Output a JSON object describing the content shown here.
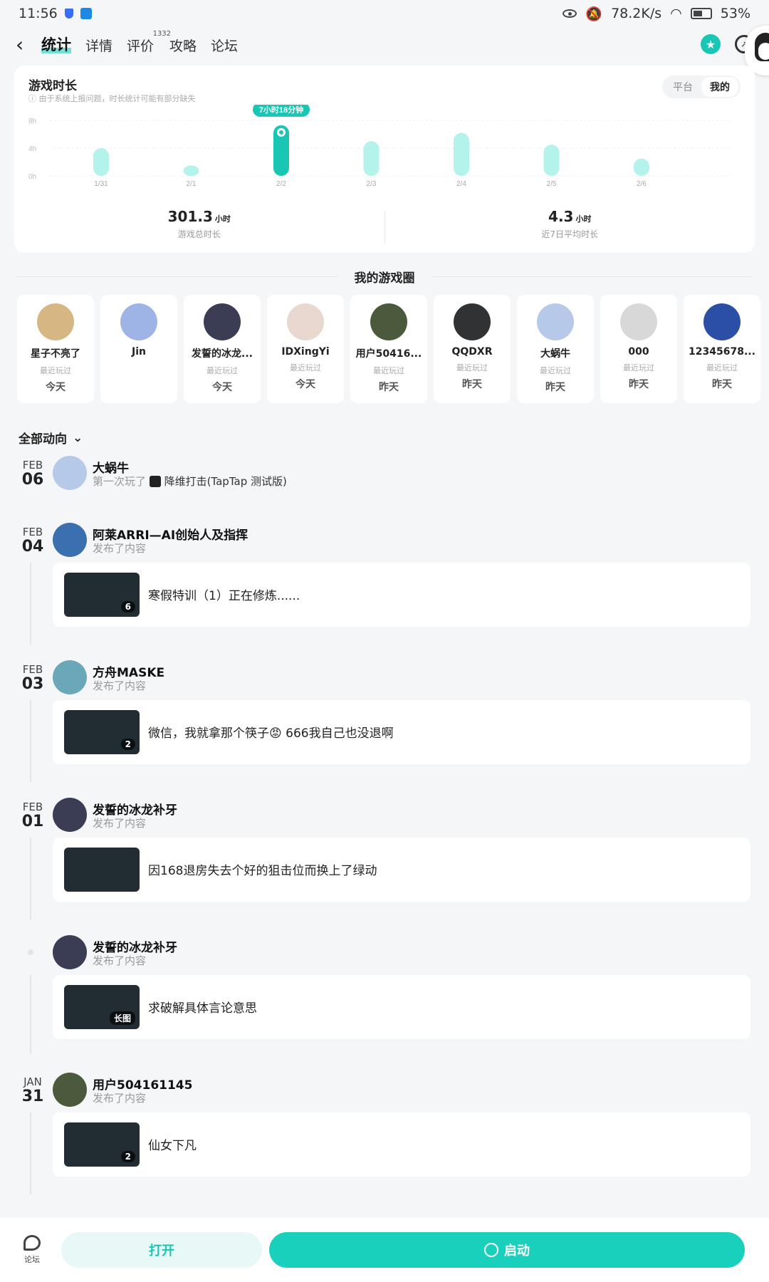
{
  "status": {
    "time": "11:56",
    "speed": "78.2K/s",
    "battery": "53%"
  },
  "header": {
    "tabs": [
      {
        "label": "统计",
        "active": true
      },
      {
        "label": "详情"
      },
      {
        "label": "评价",
        "count": "1332"
      },
      {
        "label": "攻略"
      },
      {
        "label": "论坛"
      }
    ]
  },
  "playtime": {
    "title": "游戏时长",
    "note": "ⓘ 由于系统上报问题，时长统计可能有部分缺失",
    "toggle": [
      "平台",
      "我的"
    ],
    "total_value": "301.3",
    "total_unit": "小时",
    "total_label": "游戏总时长",
    "avg_value": "4.3",
    "avg_unit": "小时",
    "avg_label": "近7日平均时长"
  },
  "chart_data": {
    "type": "bar",
    "categories": [
      "1/31",
      "2/1",
      "2/2",
      "2/3",
      "2/4",
      "2/5",
      "2/6"
    ],
    "values": [
      4.0,
      1.5,
      7.3,
      5.0,
      6.2,
      4.5,
      2.5
    ],
    "ylim": [
      0,
      8
    ],
    "yticks": [
      "0h",
      "4h",
      "8h"
    ],
    "highlight_index": 2,
    "highlight_label": "7小时18分钟",
    "grid": true,
    "colors": {
      "bar": "#b4f2ec",
      "highlight": "#19c6b3"
    }
  },
  "circle": {
    "title": "我的游戏圈",
    "label": "最近玩过",
    "friends": [
      {
        "name": "星子不亮了",
        "date": "今天",
        "color": "#d6b784"
      },
      {
        "name": "Jin",
        "date": "",
        "color": "#9fb4e6"
      },
      {
        "name": "发誓的冰龙...",
        "date": "今天",
        "color": "#3b3d55"
      },
      {
        "name": "IDXingYi",
        "date": "今天",
        "color": "#e8d8d0"
      },
      {
        "name": "用户50416...",
        "date": "昨天",
        "color": "#4b5a3c"
      },
      {
        "name": "QQDXR",
        "date": "昨天",
        "color": "#303234"
      },
      {
        "name": "大蜗牛",
        "date": "昨天",
        "color": "#b6c9e9"
      },
      {
        "name": "000",
        "date": "昨天",
        "color": "#d8d8d8"
      },
      {
        "name": "12345678...",
        "date": "昨天",
        "color": "#2c4fa6"
      }
    ]
  },
  "feed": {
    "filter": "全部动向",
    "entries": [
      {
        "mo": "FEB",
        "dy": "06",
        "name": "大蜗牛",
        "sub": "第一次玩了",
        "game": "降维打击(TapTap 测试版)",
        "color": "#b6c9e9"
      },
      {
        "mo": "FEB",
        "dy": "04",
        "name": "阿莱ARRI—AI创始人及指挥",
        "sub": "发布了内容",
        "post": "寒假特训（1）正在修炼......",
        "badge": "6",
        "color": "#3a6fb0"
      },
      {
        "mo": "FEB",
        "dy": "03",
        "name": "方舟MASKE",
        "sub": "发布了内容",
        "post": "微信，我就拿那个筷子😡 666我自己也没退啊",
        "badge": "2",
        "color": "#6aa7b8"
      },
      {
        "mo": "FEB",
        "dy": "01",
        "name": "发誓的冰龙补牙",
        "sub": "发布了内容",
        "post": "因168退房失去个好的狙击位而换上了绿动",
        "badge": "",
        "color": "#3b3d55"
      },
      {
        "mo": "",
        "dy": "",
        "name": "发誓的冰龙补牙",
        "sub": "发布了内容",
        "post": "求破解具体言论意思",
        "badge": "长图",
        "color": "#3b3d55"
      },
      {
        "mo": "JAN",
        "dy": "31",
        "name": "用户504161145",
        "sub": "发布了内容",
        "post": "仙女下凡",
        "badge": "2",
        "color": "#4b5a3c"
      }
    ]
  },
  "bottom": {
    "forum": "论坛",
    "open": "打开",
    "launch": "启动"
  }
}
